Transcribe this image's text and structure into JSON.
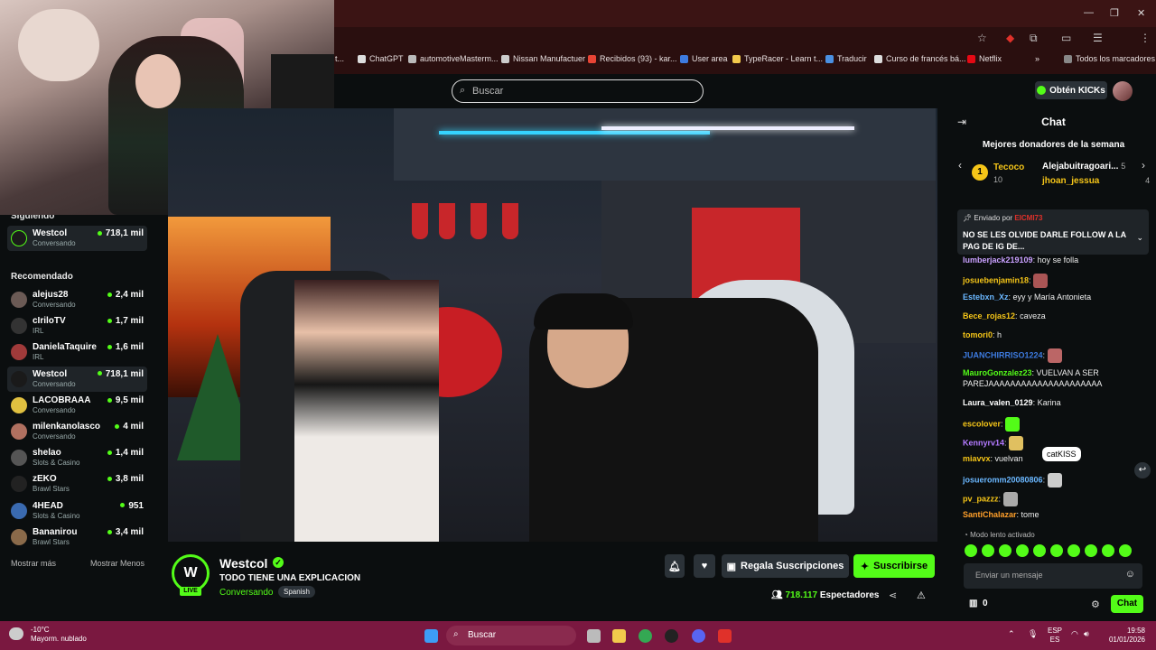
{
  "browser": {
    "bookmarks": [
      {
        "label": "ChatGPT",
        "color": "#dddddd"
      },
      {
        "label": "automotiveMasterm...",
        "color": "#bbbbbb"
      },
      {
        "label": "Nissan Manufactuer",
        "color": "#cccccc"
      },
      {
        "label": "Recibidos (93) - kar...",
        "color": "#e84435"
      },
      {
        "label": "User area",
        "color": "#3d7be0"
      },
      {
        "label": "TypeRacer - Learn t...",
        "color": "#f2c94c"
      },
      {
        "label": "Traducir",
        "color": "#4a90e2"
      },
      {
        "label": "Curso de francés bá...",
        "color": "#dddddd"
      },
      {
        "label": "Netflix",
        "color": "#e50914"
      }
    ],
    "all_bookmarks_label": "Todos los marcadores"
  },
  "header": {
    "search_placeholder": "Buscar",
    "kicks_label": "Obtén KICKs"
  },
  "sidebar": {
    "following_heading": "Siguiendo",
    "following": [
      {
        "name": "Westcol",
        "category": "Conversando",
        "viewers": "718,1 mil",
        "color": "#1a1a1a"
      }
    ],
    "recommended_heading": "Recomendado",
    "recommended": [
      {
        "name": "alejus28",
        "category": "Conversando",
        "viewers": "2,4 mil",
        "color": "#6b5a55"
      },
      {
        "name": "cIriloTV",
        "category": "IRL",
        "viewers": "1,7 mil",
        "color": "#333333"
      },
      {
        "name": "DanielaTaquire",
        "category": "IRL",
        "viewers": "1,6 mil",
        "color": "#a03a3a"
      },
      {
        "name": "Westcol",
        "category": "Conversando",
        "viewers": "718,1 mil",
        "color": "#1a1a1a"
      },
      {
        "name": "LACOBRAAA",
        "category": "Conversando",
        "viewers": "9,5 mil",
        "color": "#e0c040"
      },
      {
        "name": "milenkanolasco",
        "category": "Conversando",
        "viewers": "4 mil",
        "color": "#b07060"
      },
      {
        "name": "shelao",
        "category": "Slots & Casino",
        "viewers": "1,4 mil",
        "color": "#555555"
      },
      {
        "name": "zEKO",
        "category": "Brawl Stars",
        "viewers": "3,8 mil",
        "color": "#222222"
      },
      {
        "name": "4HEAD",
        "category": "Slots & Casino",
        "viewers": "951",
        "color": "#3a6ab0"
      },
      {
        "name": "Bananirou",
        "category": "Brawl Stars",
        "viewers": "3,4 mil",
        "color": "#8a6a4a"
      }
    ],
    "show_more": "Mostrar más",
    "show_less": "Mostrar Menos"
  },
  "channel": {
    "name": "Westcol",
    "avatar_text": "W",
    "live_label": "LIVE",
    "title": "TODO TIENE UNA EXPLICACION",
    "category": "Conversando",
    "language": "Spanish",
    "gift_label": "Regala Suscripciones",
    "subscribe_label": "Suscribirse",
    "viewers_count": "718.117",
    "viewers_label": "Espectadores",
    "accent_color": "#53fc18"
  },
  "chat": {
    "title": "Chat",
    "donors_heading": "Mejores donadores de la semana",
    "donors": [
      {
        "name": "Tecoco",
        "count": "10"
      },
      {
        "name": "Alejabuitragoari...",
        "count": "5"
      },
      {
        "name": "jhoan_jessua",
        "count": "4"
      }
    ],
    "pinned_by_label": "Enviado por",
    "pinned_user": "EICMI73",
    "pinned_message": "NO SE LES OLVIDE DARLE FOLLOW A LA PAG DE IG DE...",
    "messages": [
      {
        "user": "lumberjack219109",
        "text": "hoy se folla",
        "color": "#c9a0ff",
        "emote": ""
      },
      {
        "user": "josuebenjamin18",
        "text": "",
        "color": "#f5c518",
        "emote": "#a55"
      },
      {
        "user": "Estebxn_Xz",
        "text": "eyy y María Antonieta",
        "color": "#6ab7ff",
        "emote": ""
      },
      {
        "user": "Bece_rojas12",
        "text": "caveza",
        "color": "#f5c518",
        "emote": ""
      },
      {
        "user": "tomori0",
        "text": "h",
        "color": "#f5c518",
        "emote": ""
      },
      {
        "user": "JUANCHIRRISO1224",
        "text": "",
        "color": "#3d7be0",
        "emote": "#b66"
      },
      {
        "user": "MauroGonzalez23",
        "text": "VUELVAN A SER PAREJAAAAAAAAAAAAAAAAAAAAA",
        "color": "#53fc18",
        "emote": ""
      },
      {
        "user": "Laura_valen_0129",
        "text": "Karina",
        "color": "#ffffff",
        "emote": ""
      },
      {
        "user": "escolover",
        "text": "",
        "color": "#f5c518",
        "emote": "#53fc18"
      },
      {
        "user": "Kennyrv14",
        "text": "",
        "color": "#b37aff",
        "emote": "#e0c060"
      },
      {
        "user": "miavvx",
        "text": "vuelvan",
        "color": "#f5c518",
        "emote": ""
      },
      {
        "user": "josueromm20080806",
        "text": "",
        "color": "#6ab7ff",
        "emote": "#ccc"
      },
      {
        "user": "pv_pazzz",
        "text": "",
        "color": "#f5c518",
        "emote": "#aaa"
      },
      {
        "user": "SantiChalazar",
        "text": "tome",
        "color": "#ff9f2a",
        "emote": ""
      }
    ],
    "tooltip": "catKISS",
    "slow_mode": "Modo lento activado",
    "input_placeholder": "Enviar un mensaje",
    "kick_count": "0",
    "send_label": "Chat"
  },
  "taskbar": {
    "temperature": "-10°C",
    "weather": "Mayorm. nublado",
    "search_placeholder": "Buscar",
    "lang_top": "ESP",
    "lang_bottom": "ES",
    "time": "19:58",
    "date": "01/01/2026"
  }
}
